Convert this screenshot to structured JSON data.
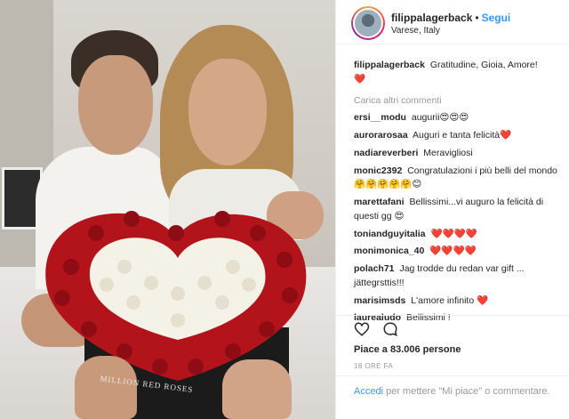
{
  "photo": {
    "box_text": "MILLION RED ROSES"
  },
  "header": {
    "username": "filippalagerback",
    "separator": "•",
    "follow_label": "Segui",
    "location": "Varese, Italy"
  },
  "caption": {
    "username": "filippalagerback",
    "text": "Gratitudine, Gioia, Amore!",
    "emoji": "❤️"
  },
  "load_more_label": "Carica altri commenti",
  "comments": [
    {
      "user": "ersi__modu",
      "text": "augurii😍😍😍"
    },
    {
      "user": "aurorarosaa",
      "text": "Auguri e tanta felicità❤️"
    },
    {
      "user": "nadiareverberi",
      "text": "Meravigliosi"
    },
    {
      "user": "monic2392",
      "text": "Congratulazioni i più belli del mondo 🤗🤗🤗🤗🤗😊"
    },
    {
      "user": "marettafani",
      "text": "Bellissimi...vi auguro la felicità di questi gg 😍"
    },
    {
      "user": "toniandguyitalia",
      "text": "❤️❤️❤️❤️"
    },
    {
      "user": "monimonica_40",
      "text": "❤️❤️❤️❤️"
    },
    {
      "user": "polach71",
      "text": "Jag trodde du redan var gift ... jättegrsttis!!!"
    },
    {
      "user": "marisimsds",
      "text": "L'amore infinito ❤️"
    },
    {
      "user": "laurealudo",
      "text": "Bellissimi !"
    }
  ],
  "actions": {
    "like_icon": "heart-outline-icon",
    "comment_icon": "speech-bubble-icon"
  },
  "likes_text": "Piace a 83.006 persone",
  "timestamp": "18 ORE FA",
  "login": {
    "link": "Accedi",
    "text": "per mettere \"Mi piace\" o commentare."
  },
  "colors": {
    "link_blue": "#3897f0",
    "muted_gray": "#999999",
    "heart_red": "#e0245e"
  }
}
